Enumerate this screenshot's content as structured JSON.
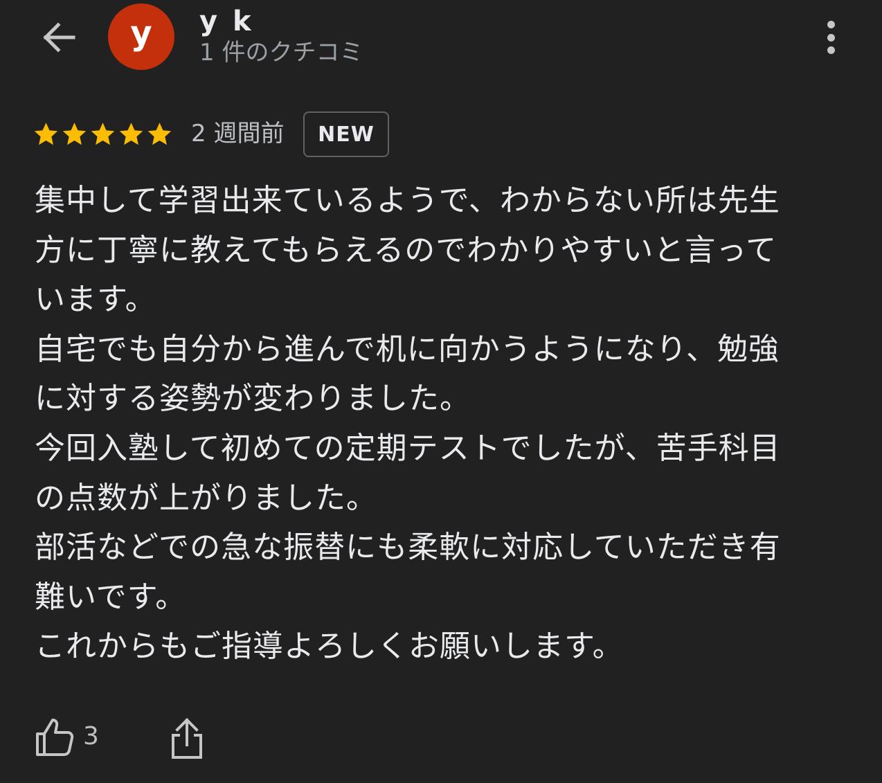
{
  "header": {
    "back_icon": "arrow-left-icon",
    "avatar_letter": "y",
    "avatar_color": "#c3300b",
    "user_name": "y k",
    "review_count": "1 件のクチコミ",
    "more_icon": "more-vert-icon"
  },
  "review": {
    "rating": 5,
    "max_rating": 5,
    "star_color": "#fbbc04",
    "date": "2 週間前",
    "badge": "NEW",
    "lines": [
      "集中して学習出来ているようで、わからない所は先生",
      "方に丁寧に教えてもらえるのでわかりやすいと言って",
      "います。",
      "自宅でも自分から進んで机に向かうようになり、勉強",
      "に対する姿勢が変わりました。",
      "今回入塾して初めての定期テストでしたが、苦手科目",
      "の点数が上がりました。",
      "部活などでの急な振替にも柔軟に対応していただき有",
      "難いです。",
      "これからもご指導よろしくお願いします。"
    ]
  },
  "actions": {
    "like_icon": "thumb-up-icon",
    "like_count": "3",
    "share_icon": "share-icon"
  }
}
